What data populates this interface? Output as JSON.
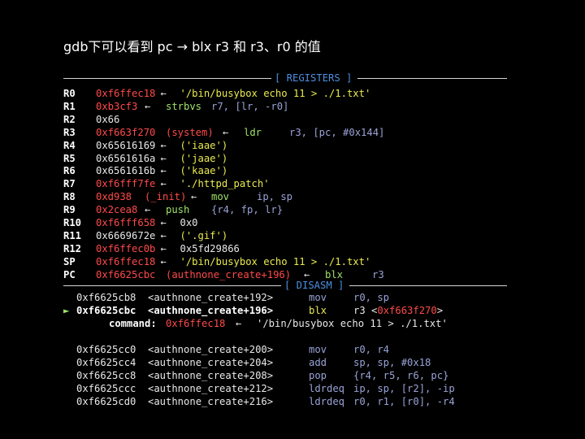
{
  "title": "gdb下可以看到 pc → blx r3 和 r3、r0 的值",
  "registers_header": "[ REGISTERS ]",
  "disasm_header": "[ DISASM ]",
  "arrow": "←",
  "pc_marker": "►",
  "registers": [
    {
      "name": "R0",
      "value": "0xf6ffec18",
      "rest": "'/bin/busybox echo 11 > ./1.txt'"
    },
    {
      "name": "R1",
      "value": "0xb3cf3",
      "mnemonic": "strbvs",
      "operands": "r7, [lr, -r0]"
    },
    {
      "name": "R2",
      "value": "0x66"
    },
    {
      "name": "R3",
      "value": "0xf663f270",
      "symbol": "(system)",
      "mnemonic": "ldr",
      "operands": "r3, [pc, #0x144]"
    },
    {
      "name": "R4",
      "value": "0x65616169",
      "rest": "('iaae')"
    },
    {
      "name": "R5",
      "value": "0x6561616a",
      "rest": "('jaae')"
    },
    {
      "name": "R6",
      "value": "0x6561616b",
      "rest": "('kaae')"
    },
    {
      "name": "R7",
      "value": "0xf6fff7fe",
      "rest": "'./httpd_patch'"
    },
    {
      "name": "R8",
      "value": "0xd938",
      "symbol": "(_init)",
      "mnemonic": "mov",
      "operands": "ip, sp"
    },
    {
      "name": "R9",
      "value": "0x2cea8",
      "mnemonic": "push",
      "operands": "{r4, fp, lr}"
    },
    {
      "name": "R10",
      "value": "0xf6fff658",
      "rest": "0x0"
    },
    {
      "name": "R11",
      "value": "0x6669672e",
      "rest": "('.gif')"
    },
    {
      "name": "R12",
      "value": "0xf6ffec0b",
      "rest": "0x5fd29866"
    },
    {
      "name": "SP",
      "value": "0xf6ffec18",
      "rest": "'/bin/busybox echo 11 > ./1.txt'"
    },
    {
      "name": "PC",
      "value": "0xf6625cbc",
      "symbol": "(authnone_create+196)",
      "mnemonic": "blx",
      "operands": "r3"
    }
  ],
  "disasm_top": [
    {
      "addr": "0xf6625cb8",
      "sym": "<authnone_create+192>",
      "mnemonic": "mov",
      "operands": "r0, sp"
    },
    {
      "addr": "0xf6625cbc",
      "sym": "<authnone_create+196>",
      "mnemonic": "blx",
      "operands": "r3 <0xf663f270>",
      "current": true
    }
  ],
  "command": {
    "label": "command:",
    "value": "0xf6ffec18",
    "rest": "'/bin/busybox echo 11 > ./1.txt'"
  },
  "disasm_bottom": [
    {
      "addr": "0xf6625cc0",
      "sym": "<authnone_create+200>",
      "mnemonic": "mov",
      "operands": "r0, r4"
    },
    {
      "addr": "0xf6625cc4",
      "sym": "<authnone_create+204>",
      "mnemonic": "add",
      "operands": "sp, sp, #0x18"
    },
    {
      "addr": "0xf6625cc8",
      "sym": "<authnone_create+208>",
      "mnemonic": "pop",
      "operands": "{r4, r5, r6, pc}"
    },
    {
      "addr": "0xf6625ccc",
      "sym": "<authnone_create+212>",
      "mnemonic": "ldrdeq",
      "operands": "ip, sp, [r2], -ip"
    },
    {
      "addr": "0xf6625cd0",
      "sym": "<authnone_create+216>",
      "mnemonic": "ldrdeq",
      "operands": "r0, r1, [r0], -r4"
    }
  ]
}
